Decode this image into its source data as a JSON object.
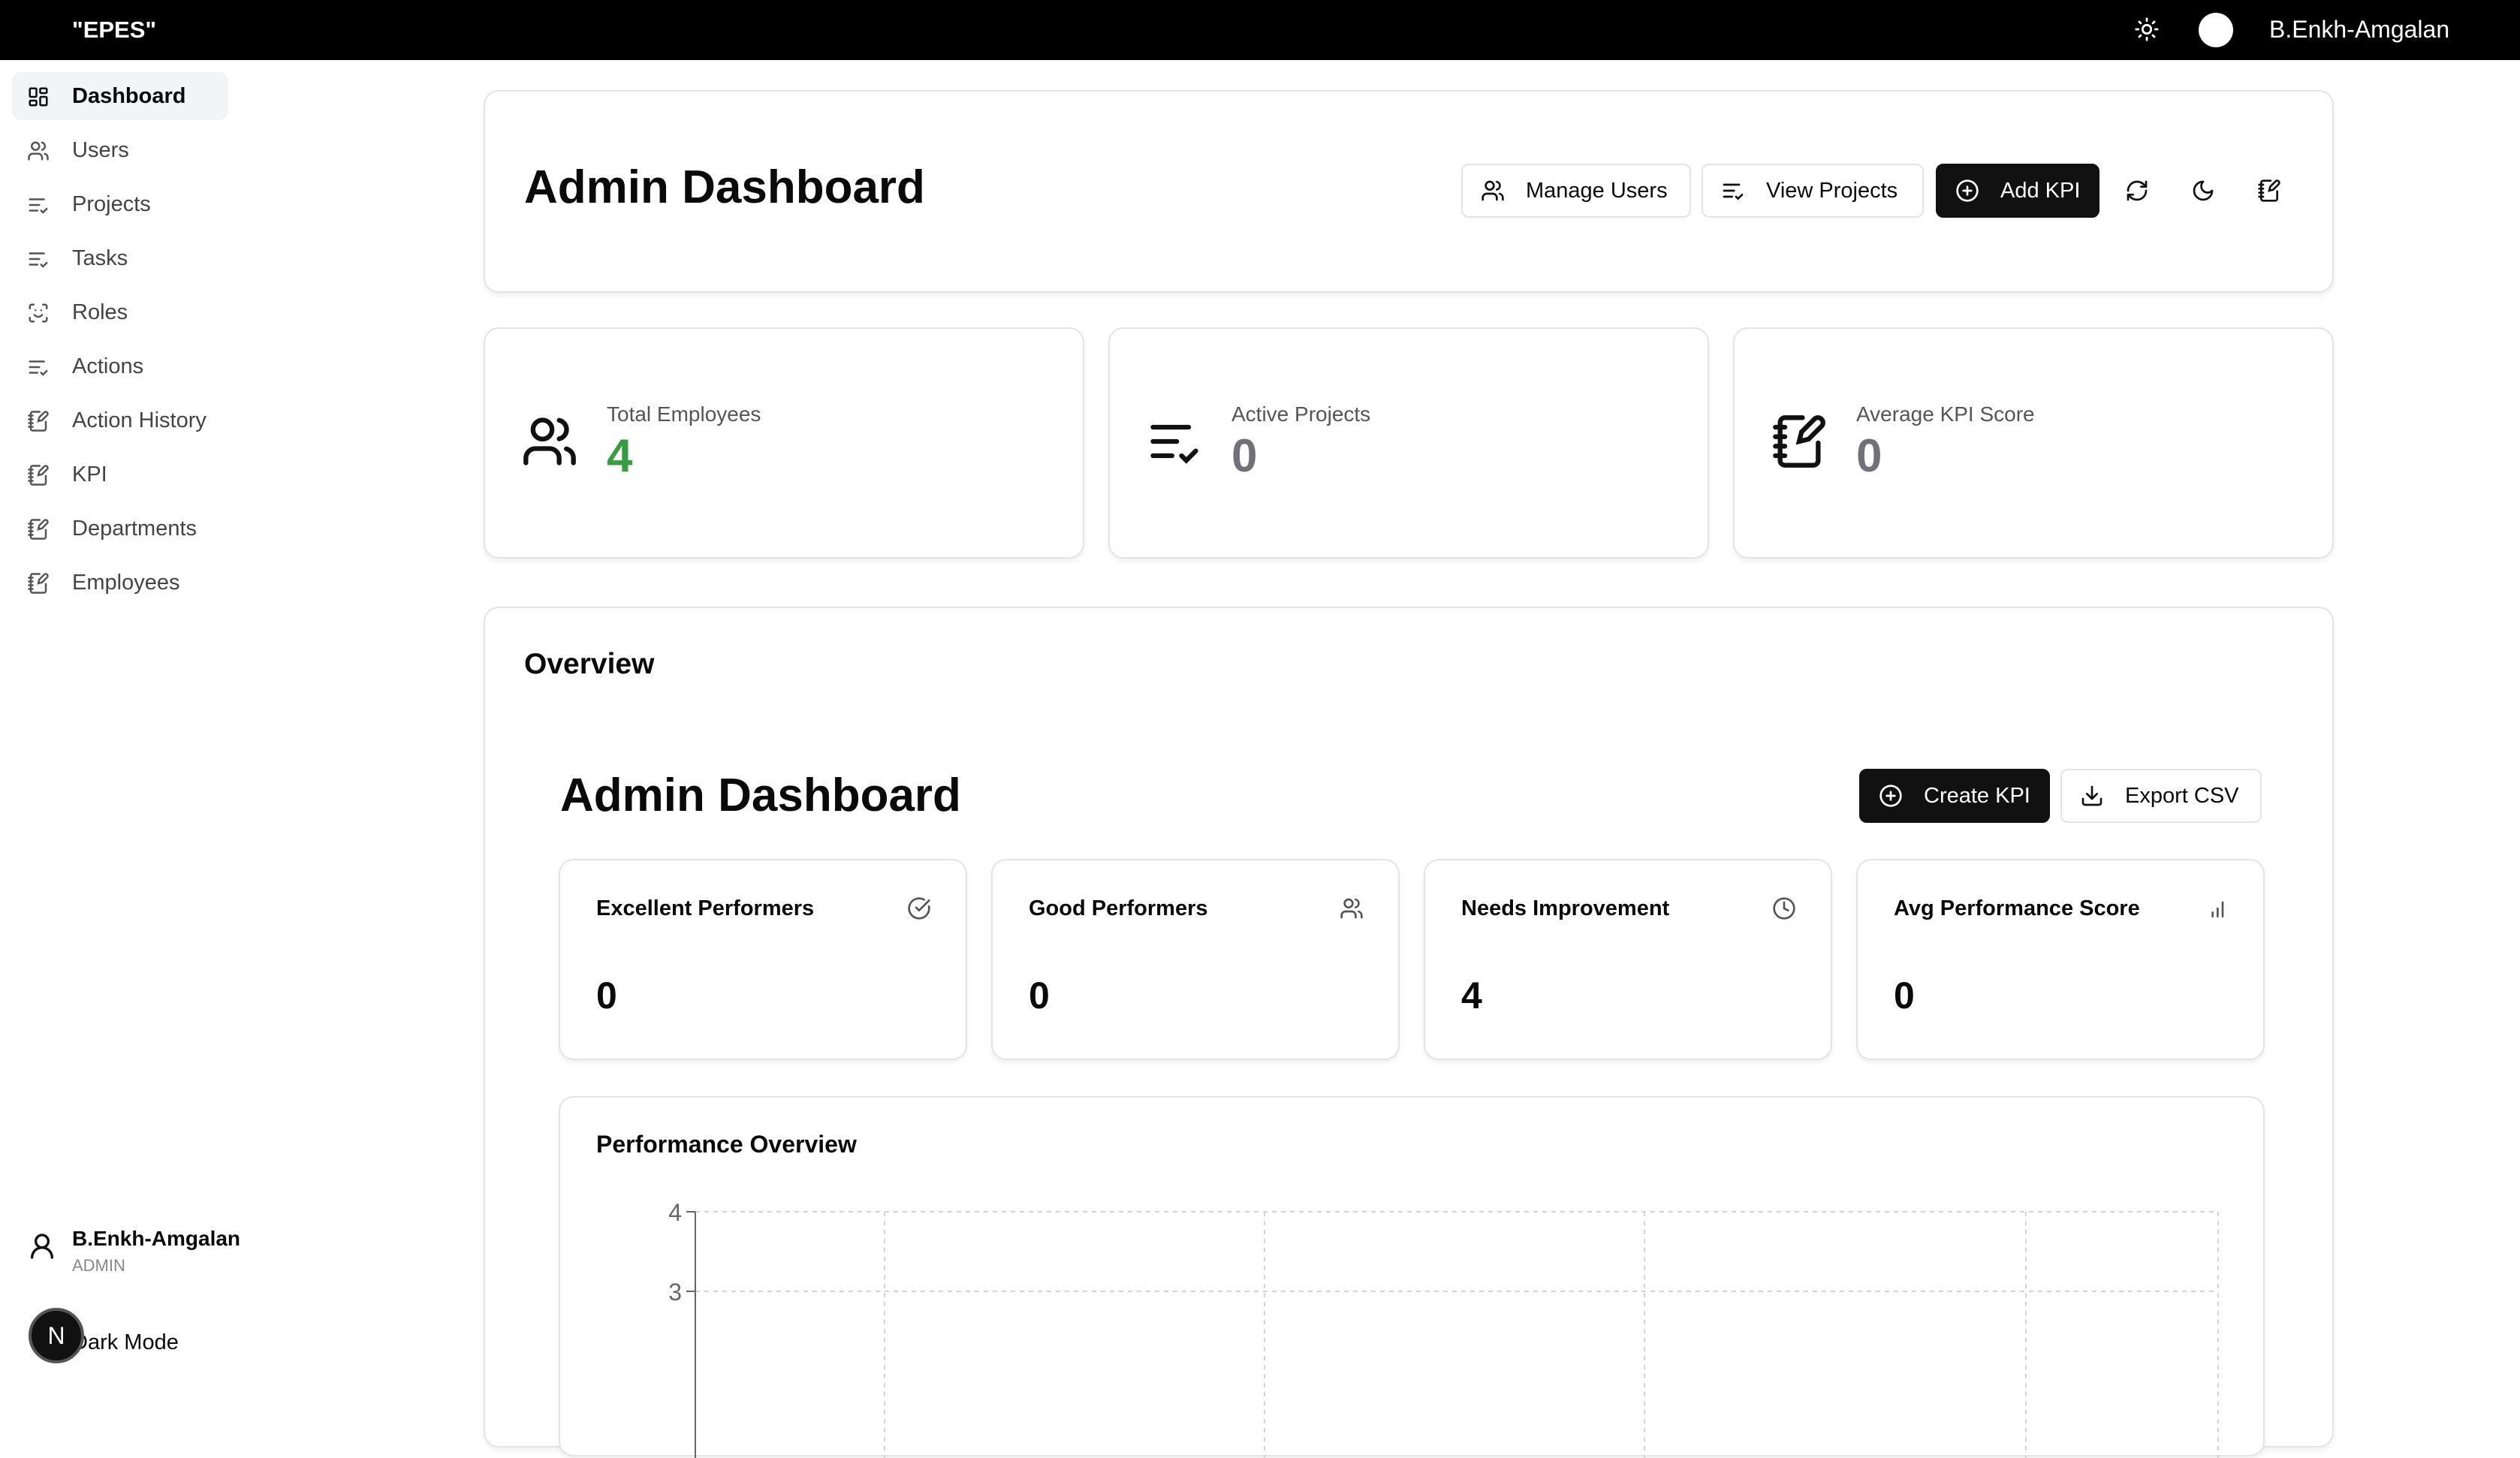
{
  "app": {
    "brand": "\"EPES\"",
    "user_name": "B.Enkh-Amgalan"
  },
  "sidebar": {
    "items": [
      {
        "label": "Dashboard",
        "icon": "dashboard-icon"
      },
      {
        "label": "Users",
        "icon": "users-icon"
      },
      {
        "label": "Projects",
        "icon": "list-check-icon"
      },
      {
        "label": "Tasks",
        "icon": "list-check-icon"
      },
      {
        "label": "Roles",
        "icon": "scan-face-icon"
      },
      {
        "label": "Actions",
        "icon": "list-check-icon"
      },
      {
        "label": "Action History",
        "icon": "notebook-pen-icon"
      },
      {
        "label": "KPI",
        "icon": "notebook-pen-icon"
      },
      {
        "label": "Departments",
        "icon": "notebook-pen-icon"
      },
      {
        "label": "Employees",
        "icon": "notebook-pen-icon"
      }
    ],
    "active_index": 0,
    "user": {
      "name": "B.Enkh-Amgalan",
      "role": "ADMIN"
    },
    "dark_mode_label": "Dark Mode",
    "badge_letter": "N"
  },
  "header": {
    "title": "Admin Dashboard",
    "buttons": {
      "manage_users": "Manage Users",
      "view_projects": "View Projects",
      "add_kpi": "Add KPI"
    }
  },
  "stats": [
    {
      "label": "Total Employees",
      "value": "4",
      "color": "#3a9b45"
    },
    {
      "label": "Active Projects",
      "value": "0",
      "color": "#71717a"
    },
    {
      "label": "Average KPI Score",
      "value": "0",
      "color": "#71717a"
    }
  ],
  "overview": {
    "title": "Overview",
    "inner_title": "Admin Dashboard",
    "create_kpi": "Create KPI",
    "export_csv": "Export CSV",
    "mini_stats": [
      {
        "label": "Excellent Performers",
        "value": "0",
        "icon": "check-circle-icon"
      },
      {
        "label": "Good Performers",
        "value": "0",
        "icon": "users-icon"
      },
      {
        "label": "Needs Improvement",
        "value": "4",
        "icon": "clock-icon"
      },
      {
        "label": "Avg Performance Score",
        "value": "0",
        "icon": "bar-chart-icon"
      }
    ]
  },
  "chart_data": {
    "type": "bar",
    "title": "Performance Overview",
    "y_ticks": [
      "4",
      "3"
    ],
    "ylim_visible": [
      3,
      4
    ],
    "grid": true,
    "categories": [],
    "values": []
  }
}
